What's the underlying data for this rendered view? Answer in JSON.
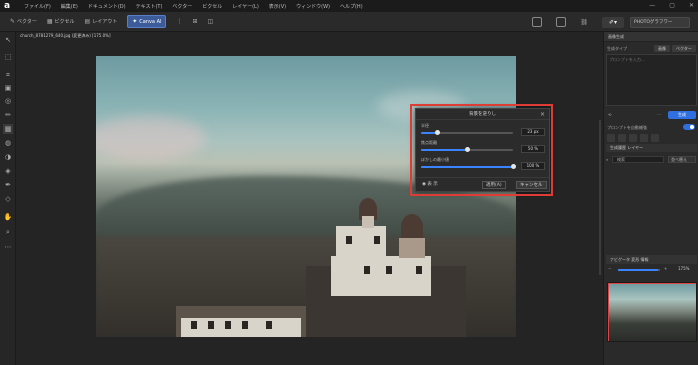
{
  "app": {
    "logo": "a"
  },
  "menu": [
    "ファイル(F)",
    "編集(E)",
    "ドキュメント(D)",
    "テキスト(T)",
    "ベクター",
    "ピクセル",
    "レイヤー(L)",
    "表示(V)",
    "ウィンドウ(W)",
    "ヘルプ(H)"
  ],
  "window_controls": [
    "—",
    "▢",
    "✕"
  ],
  "toolbar": {
    "vector": "ベクター",
    "pixel": "ピクセル",
    "layout": "レイアウト",
    "canvas_ai": "Canva AI",
    "workspace": "PHOTOグラフワー"
  },
  "document": {
    "tab_title": "church_8781279_640.jpg (変更済み) [175.0%]"
  },
  "dialog": {
    "title": "背景を逆りし",
    "params": [
      {
        "label": "半径",
        "value": "23 px",
        "fraction": 0.18
      },
      {
        "label": "焦点距離",
        "value": "50 %",
        "fraction": 0.5
      },
      {
        "label": "ぼかしの最小値",
        "value": "100 %",
        "fraction": 1.0
      }
    ],
    "preview": "表 示",
    "apply": "適用(A)",
    "cancel": "キャンセル"
  },
  "right_panel": {
    "header": "画像生成",
    "section_label": "生成タイプ",
    "tabs": [
      "画像",
      "ベクター"
    ],
    "prompt_placeholder": "プロンプトを入力...",
    "generate": "生成",
    "toggle_label": "プロンプトを自動補強",
    "section2": "生成履歴  レイヤー",
    "search_placeholder": "検索",
    "sort": "並べ替え",
    "navigator_header": "ナビゲータ  変形  情報",
    "zoom": "175%"
  },
  "colors": {
    "accent": "#3c84ff",
    "highlight": "#e03c36"
  }
}
